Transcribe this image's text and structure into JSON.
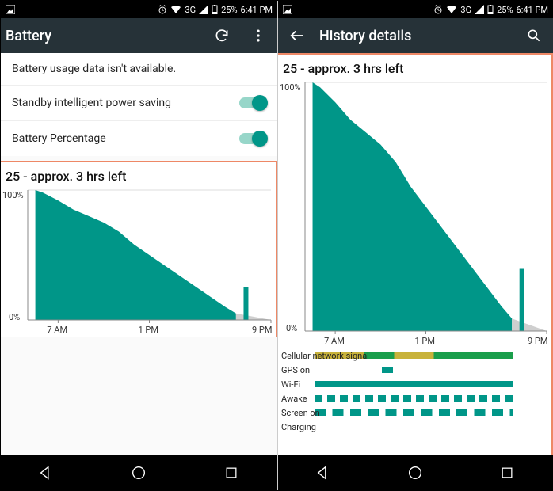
{
  "status": {
    "left_icon": "picture",
    "alarm": "alarm",
    "wifi": "wifi",
    "network": "3G",
    "signal": "signal",
    "battery_pct": "25%",
    "time": "6:41 PM",
    "right_icon": "picture"
  },
  "left": {
    "title": "Battery",
    "msg_unavailable": "Battery usage data isn't available.",
    "setting_standby": "Standby intelligent power saving",
    "setting_pct": "Battery Percentage",
    "standby_on": true,
    "pct_on": true
  },
  "right": {
    "title": "History details"
  },
  "tracks": {
    "cell": "Cellular network signal",
    "gps": "GPS on",
    "wifi": "Wi-Fi",
    "awake": "Awake",
    "screen": "Screen on",
    "charging": "Charging"
  },
  "chart_data": {
    "type": "area",
    "title": "25 - approx. 3 hrs left",
    "ylabel_top": "100%",
    "ylabel_bottom": "0%",
    "xticks": [
      "7 AM",
      "1 PM",
      "9 PM"
    ],
    "x_range_hours": [
      5,
      21
    ],
    "now_hour": 18.7,
    "x": [
      5.5,
      6,
      7,
      8,
      9,
      10,
      11,
      12,
      13,
      14,
      15,
      16,
      17,
      18,
      18.7
    ],
    "values": [
      100,
      98,
      92,
      85,
      80,
      75,
      68,
      58,
      50,
      42,
      34,
      26,
      18,
      10,
      5
    ],
    "projection": {
      "to_hour": 21,
      "to_value": 0
    },
    "bar": {
      "hour": 19.2,
      "value": 25
    },
    "colors": {
      "area": "#009688",
      "proj": "#cfcfcf",
      "bar": "#009688"
    }
  }
}
